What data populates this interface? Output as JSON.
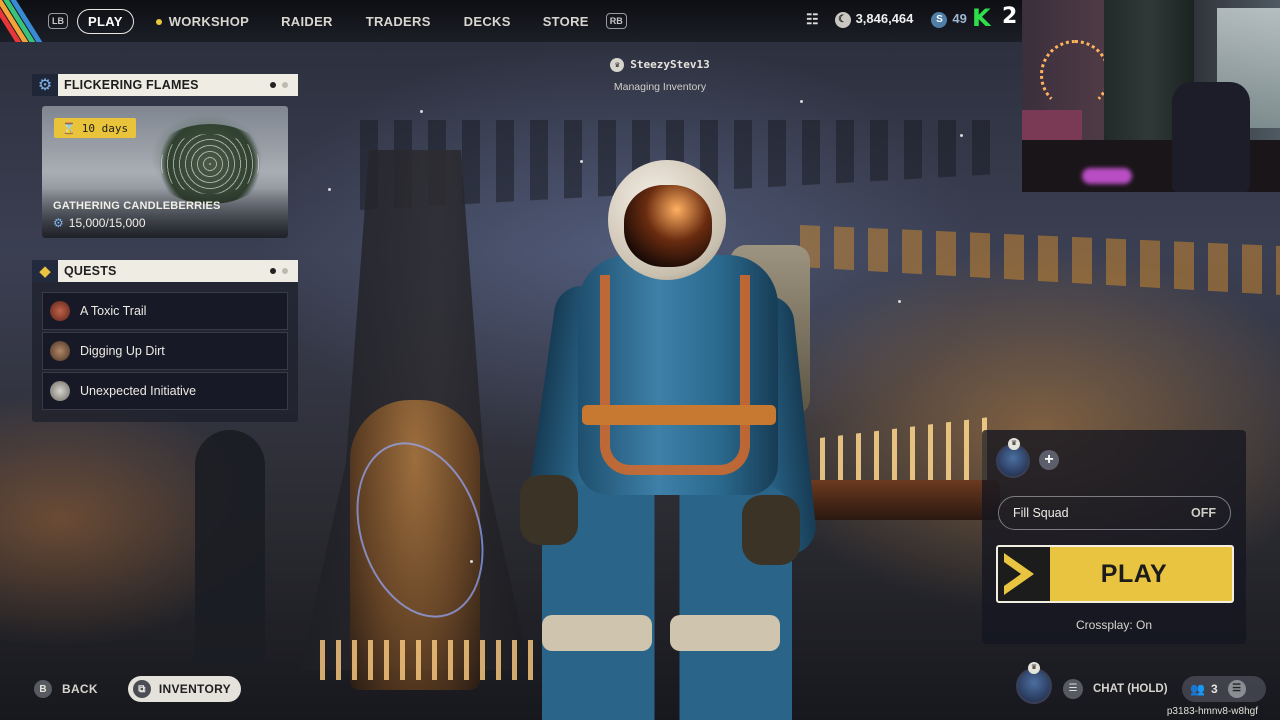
{
  "nav": {
    "lb_hint": "LB",
    "rb_hint": "RB",
    "items": [
      "PLAY",
      "WORKSHOP",
      "RAIDER",
      "TRADERS",
      "DECKS",
      "STORE"
    ],
    "active": "PLAY"
  },
  "currency": {
    "coins": "3,846,464",
    "premium": "49"
  },
  "overlay_badge": {
    "letter": "K",
    "number": "2"
  },
  "player": {
    "name": "SteezyStev13",
    "status": "Managing Inventory"
  },
  "event": {
    "title": "FLICKERING FLAMES",
    "timer": "10 days",
    "name": "GATHERING CANDLEBERRIES",
    "progress": "15,000/15,000"
  },
  "quests": {
    "title": "QUESTS",
    "items": [
      {
        "label": "A Toxic Trail",
        "color": "#8a3b2a"
      },
      {
        "label": "Digging Up Dirt",
        "color": "#7a5a40"
      },
      {
        "label": "Unexpected Initiative",
        "color": "#9a9a92"
      }
    ]
  },
  "squad": {
    "fill_label": "Fill Squad",
    "fill_value": "OFF",
    "play_label": "PLAY",
    "crossplay": "Crossplay: On"
  },
  "bottom": {
    "back_hint": "B",
    "back_label": "BACK",
    "inventory_label": "INVENTORY",
    "chat_label": "CHAT (HOLD)",
    "party_count": "3",
    "build_id": "p3183-hmnv8-w8hgf"
  },
  "colors": {
    "accent_yellow": "#e8c441",
    "panel_header": "#efece4",
    "stripe_colors": [
      "#e8373a",
      "#f2a33a",
      "#39c27a",
      "#3a8bd6"
    ]
  }
}
